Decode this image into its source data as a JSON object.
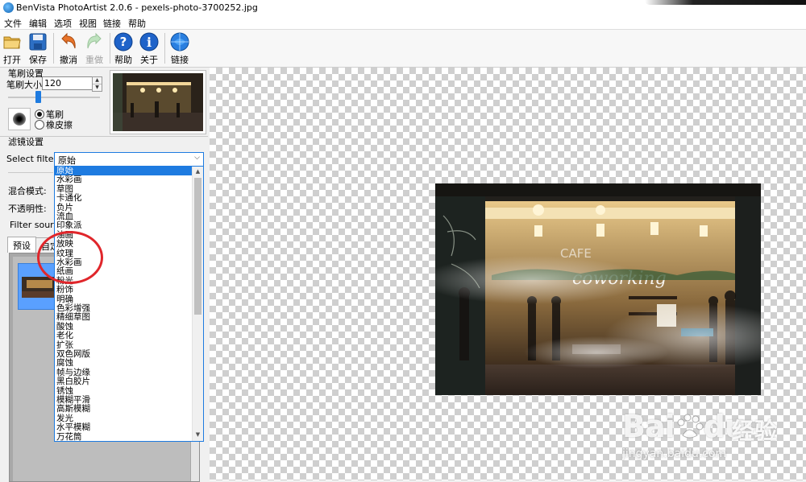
{
  "window": {
    "title": "BenVista PhotoArtist 2.0.6 - pexels-photo-3700252.jpg"
  },
  "menu": [
    "文件",
    "编辑",
    "选项",
    "视图",
    "链接",
    "帮助"
  ],
  "toolbar": {
    "open": "打开",
    "save": "保存",
    "undo": "撤消",
    "redo": "重做",
    "help": "帮助",
    "about": "关于",
    "link": "链接"
  },
  "brush_settings": {
    "title": "笔刷设置",
    "size_label": "笔刷大小:",
    "size_value": "120",
    "brush_label": "笔刷",
    "eraser_label": "橡皮擦",
    "selected": "笔刷"
  },
  "filter_settings": {
    "title": "滤镜设置",
    "select_label": "Select filter:",
    "selected": "原始",
    "blend_mode_label": "混合模式:",
    "opacity_label": "不透明性:",
    "filter_source_label": "Filter source:"
  },
  "tabs": {
    "preset": "预设",
    "custom": "自定"
  },
  "filter_options": [
    "原始",
    "水彩画",
    "草图",
    "卡通化",
    "负片",
    "流血",
    "印象派",
    "油画",
    "放映",
    "纹理",
    "水彩画",
    "纸画",
    "粉光",
    "粉饰",
    "明确",
    "色彩增强",
    "精细草图",
    "酸蚀",
    "老化",
    "扩张",
    "双色网版",
    "腐蚀",
    "帧与边缘",
    "黑白胶片",
    "锈蚀",
    "模糊平滑",
    "高斯模糊",
    "发光",
    "水平模糊",
    "万花筒"
  ],
  "photo": {
    "sign_text": "coworking",
    "sign_top": "CAFE"
  },
  "watermark": {
    "brand": "Bai",
    "brand_tail": "du",
    "cn": "经验",
    "url": "jingyan.baidu.com"
  },
  "colors": {
    "accent": "#1e7be0",
    "annotation": "#e0262b"
  }
}
